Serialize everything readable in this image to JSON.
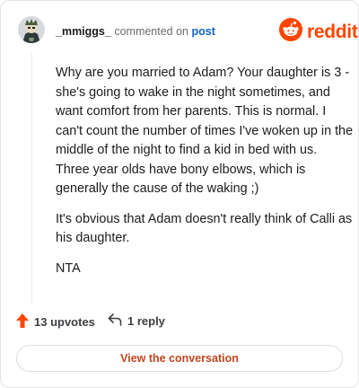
{
  "comment": {
    "username": "_mmiggs_",
    "commented_on_label": "commented on",
    "post_link_label": "post",
    "paragraphs": [
      "Why are you married to Adam? Your daughter is 3 - she's going to wake in the night sometimes, and want comfort from her parents. This is normal. I can't count the number of times I've woken up in the middle of the night to find a kid in bed with us. Three year olds have bony elbows, which is generally the cause of the waking ;)",
      "It's obvious that Adam doesn't really think of Calli as his daughter.",
      "NTA"
    ]
  },
  "brand": {
    "logo_text": "reddit",
    "color": "#ff4500"
  },
  "footer": {
    "upvotes_label": "13 upvotes",
    "replies_label": "1 reply"
  },
  "cta": {
    "label": "View the conversation"
  }
}
